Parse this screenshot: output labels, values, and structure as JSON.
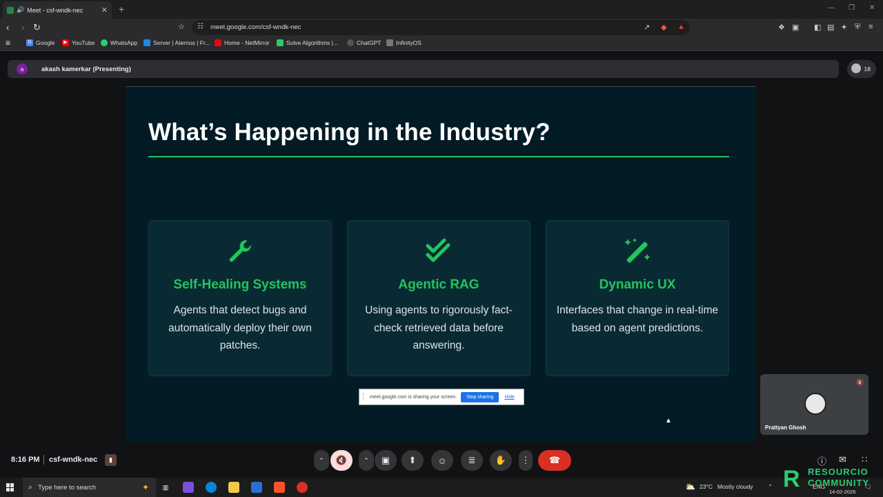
{
  "browser": {
    "tab_title": "Meet - csf-wndk-nec",
    "url": "meet.google.com/csf-wndk-nec",
    "bookmarks": [
      {
        "label": "Google",
        "icon": "google-icon",
        "color": "#4285f4"
      },
      {
        "label": "YouTube",
        "icon": "youtube-icon",
        "color": "#ff0000"
      },
      {
        "label": "WhatsApp",
        "icon": "whatsapp-icon",
        "color": "#25d366"
      },
      {
        "label": "Server | Aternos | Fr...",
        "icon": "aternos-icon",
        "color": "#1e88e5"
      },
      {
        "label": "Home - NetMirror",
        "icon": "netmirror-icon",
        "color": "#e50914"
      },
      {
        "label": "Solve Algorithms |...",
        "icon": "hackerrank-icon",
        "color": "#2ec866"
      },
      {
        "label": "ChatGPT",
        "icon": "chatgpt-icon",
        "color": "#555555"
      },
      {
        "label": "InfinityOS",
        "icon": "infinityos-icon",
        "color": "#777777"
      }
    ]
  },
  "meet": {
    "presenter_initial": "a",
    "presenter_label": "akash kamerkar (Presenting)",
    "participant_count": "18",
    "time": "8:16 PM",
    "meeting_code": "csf-wndk-nec",
    "self_view_name": "Prattyan Ghosh",
    "share_notice": {
      "text": "meet.google.com is sharing your screen.",
      "stop_label": "Stop sharing",
      "hide_label": "Hide"
    }
  },
  "slide": {
    "title": "What’s Happening in the Industry?",
    "accent_color": "#22c55e",
    "cards": [
      {
        "icon": "wrench-icon",
        "title": "Self-Healing Systems",
        "desc": "Agents that detect bugs and automatically deploy their own patches."
      },
      {
        "icon": "double-check-icon",
        "title": "Agentic RAG",
        "desc": "Using agents to rigorously fact-check retrieved data before answering."
      },
      {
        "icon": "magic-wand-icon",
        "title": "Dynamic UX",
        "desc": "Interfaces that change in real-time based on agent predictions."
      }
    ]
  },
  "taskbar": {
    "search_placeholder": "Type here to search",
    "weather_temp": "23°C",
    "weather_desc": "Mostly cloudy",
    "lang": "ENG",
    "date": "14-02-2026"
  },
  "watermark": {
    "line1": "RESOURCIO",
    "line2": "COMMUNITY"
  }
}
